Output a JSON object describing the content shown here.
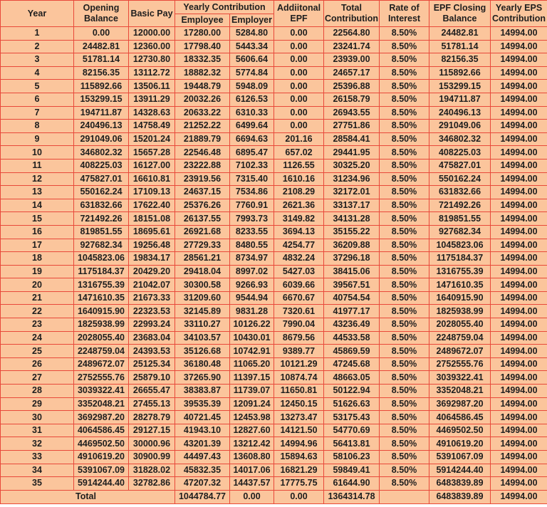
{
  "headers": {
    "year": "Year",
    "opening_balance": [
      "Opening",
      "Balance"
    ],
    "basic_pay": "Basic Pay",
    "yearly_contribution": "Yearly Contribution",
    "employee": "Employee",
    "employer": "Employer",
    "additional_epf": [
      "Addiitonal",
      "EPF"
    ],
    "total_contribution": [
      "Total",
      "Contribution"
    ],
    "rate_of_interest": [
      "Rate of",
      "Interest"
    ],
    "epf_closing_balance": [
      "EPF Closing",
      "Balance"
    ],
    "yearly_eps_contribution": [
      "Yearly EPS",
      "Contribution"
    ]
  },
  "rows": [
    [
      "1",
      "0.00",
      "12000.00",
      "17280.00",
      "5284.80",
      "0.00",
      "22564.80",
      "8.50%",
      "24482.81",
      "14994.00"
    ],
    [
      "2",
      "24482.81",
      "12360.00",
      "17798.40",
      "5443.34",
      "0.00",
      "23241.74",
      "8.50%",
      "51781.14",
      "14994.00"
    ],
    [
      "3",
      "51781.14",
      "12730.80",
      "18332.35",
      "5606.64",
      "0.00",
      "23939.00",
      "8.50%",
      "82156.35",
      "14994.00"
    ],
    [
      "4",
      "82156.35",
      "13112.72",
      "18882.32",
      "5774.84",
      "0.00",
      "24657.17",
      "8.50%",
      "115892.66",
      "14994.00"
    ],
    [
      "5",
      "115892.66",
      "13506.11",
      "19448.79",
      "5948.09",
      "0.00",
      "25396.88",
      "8.50%",
      "153299.15",
      "14994.00"
    ],
    [
      "6",
      "153299.15",
      "13911.29",
      "20032.26",
      "6126.53",
      "0.00",
      "26158.79",
      "8.50%",
      "194711.87",
      "14994.00"
    ],
    [
      "7",
      "194711.87",
      "14328.63",
      "20633.22",
      "6310.33",
      "0.00",
      "26943.55",
      "8.50%",
      "240496.13",
      "14994.00"
    ],
    [
      "8",
      "240496.13",
      "14758.49",
      "21252.22",
      "6499.64",
      "0.00",
      "27751.86",
      "8.50%",
      "291049.06",
      "14994.00"
    ],
    [
      "9",
      "291049.06",
      "15201.24",
      "21889.79",
      "6694.63",
      "201.16",
      "28584.41",
      "8.50%",
      "346802.32",
      "14994.00"
    ],
    [
      "10",
      "346802.32",
      "15657.28",
      "22546.48",
      "6895.47",
      "657.02",
      "29441.95",
      "8.50%",
      "408225.03",
      "14994.00"
    ],
    [
      "11",
      "408225.03",
      "16127.00",
      "23222.88",
      "7102.33",
      "1126.55",
      "30325.20",
      "8.50%",
      "475827.01",
      "14994.00"
    ],
    [
      "12",
      "475827.01",
      "16610.81",
      "23919.56",
      "7315.40",
      "1610.16",
      "31234.96",
      "8.50%",
      "550162.24",
      "14994.00"
    ],
    [
      "13",
      "550162.24",
      "17109.13",
      "24637.15",
      "7534.86",
      "2108.29",
      "32172.01",
      "8.50%",
      "631832.66",
      "14994.00"
    ],
    [
      "14",
      "631832.66",
      "17622.40",
      "25376.26",
      "7760.91",
      "2621.36",
      "33137.17",
      "8.50%",
      "721492.26",
      "14994.00"
    ],
    [
      "15",
      "721492.26",
      "18151.08",
      "26137.55",
      "7993.73",
      "3149.82",
      "34131.28",
      "8.50%",
      "819851.55",
      "14994.00"
    ],
    [
      "16",
      "819851.55",
      "18695.61",
      "26921.68",
      "8233.55",
      "3694.13",
      "35155.22",
      "8.50%",
      "927682.34",
      "14994.00"
    ],
    [
      "17",
      "927682.34",
      "19256.48",
      "27729.33",
      "8480.55",
      "4254.77",
      "36209.88",
      "8.50%",
      "1045823.06",
      "14994.00"
    ],
    [
      "18",
      "1045823.06",
      "19834.17",
      "28561.21",
      "8734.97",
      "4832.24",
      "37296.18",
      "8.50%",
      "1175184.37",
      "14994.00"
    ],
    [
      "19",
      "1175184.37",
      "20429.20",
      "29418.04",
      "8997.02",
      "5427.03",
      "38415.06",
      "8.50%",
      "1316755.39",
      "14994.00"
    ],
    [
      "20",
      "1316755.39",
      "21042.07",
      "30300.58",
      "9266.93",
      "6039.66",
      "39567.51",
      "8.50%",
      "1471610.35",
      "14994.00"
    ],
    [
      "21",
      "1471610.35",
      "21673.33",
      "31209.60",
      "9544.94",
      "6670.67",
      "40754.54",
      "8.50%",
      "1640915.90",
      "14994.00"
    ],
    [
      "22",
      "1640915.90",
      "22323.53",
      "32145.89",
      "9831.28",
      "7320.61",
      "41977.17",
      "8.50%",
      "1825938.99",
      "14994.00"
    ],
    [
      "23",
      "1825938.99",
      "22993.24",
      "33110.27",
      "10126.22",
      "7990.04",
      "43236.49",
      "8.50%",
      "2028055.40",
      "14994.00"
    ],
    [
      "24",
      "2028055.40",
      "23683.04",
      "34103.57",
      "10430.01",
      "8679.56",
      "44533.58",
      "8.50%",
      "2248759.04",
      "14994.00"
    ],
    [
      "25",
      "2248759.04",
      "24393.53",
      "35126.68",
      "10742.91",
      "9389.77",
      "45869.59",
      "8.50%",
      "2489672.07",
      "14994.00"
    ],
    [
      "26",
      "2489672.07",
      "25125.34",
      "36180.48",
      "11065.20",
      "10121.29",
      "47245.68",
      "8.50%",
      "2752555.76",
      "14994.00"
    ],
    [
      "27",
      "2752555.76",
      "25879.10",
      "37265.90",
      "11397.15",
      "10874.74",
      "48663.05",
      "8.50%",
      "3039322.41",
      "14994.00"
    ],
    [
      "28",
      "3039322.41",
      "26655.47",
      "38383.87",
      "11739.07",
      "11650.81",
      "50122.94",
      "8.50%",
      "3352048.21",
      "14994.00"
    ],
    [
      "29",
      "3352048.21",
      "27455.13",
      "39535.39",
      "12091.24",
      "12450.15",
      "51626.63",
      "8.50%",
      "3692987.20",
      "14994.00"
    ],
    [
      "30",
      "3692987.20",
      "28278.79",
      "40721.45",
      "12453.98",
      "13273.47",
      "53175.43",
      "8.50%",
      "4064586.45",
      "14994.00"
    ],
    [
      "31",
      "4064586.45",
      "29127.15",
      "41943.10",
      "12827.60",
      "14121.50",
      "54770.69",
      "8.50%",
      "4469502.50",
      "14994.00"
    ],
    [
      "32",
      "4469502.50",
      "30000.96",
      "43201.39",
      "13212.42",
      "14994.96",
      "56413.81",
      "8.50%",
      "4910619.20",
      "14994.00"
    ],
    [
      "33",
      "4910619.20",
      "30900.99",
      "44497.43",
      "13608.80",
      "15894.63",
      "58106.23",
      "8.50%",
      "5391067.09",
      "14994.00"
    ],
    [
      "34",
      "5391067.09",
      "31828.02",
      "45832.35",
      "14017.06",
      "16821.29",
      "59849.41",
      "8.50%",
      "5914244.40",
      "14994.00"
    ],
    [
      "35",
      "5914244.40",
      "32782.86",
      "47207.32",
      "14437.57",
      "17775.75",
      "61644.90",
      "8.50%",
      "6483839.89",
      "14994.00"
    ]
  ],
  "total": {
    "label": "Total",
    "employee": "1044784.77",
    "employer": "0.00",
    "additional_epf": "0.00",
    "total_contribution": "1364314.78",
    "rate_of_interest": "",
    "epf_closing_balance": "6483839.89",
    "yearly_eps_contribution": "14994.00"
  },
  "colors": {
    "cell_background": "#fbc59c",
    "grid_lines": "#e8493a",
    "text": "#1e1e1e"
  }
}
